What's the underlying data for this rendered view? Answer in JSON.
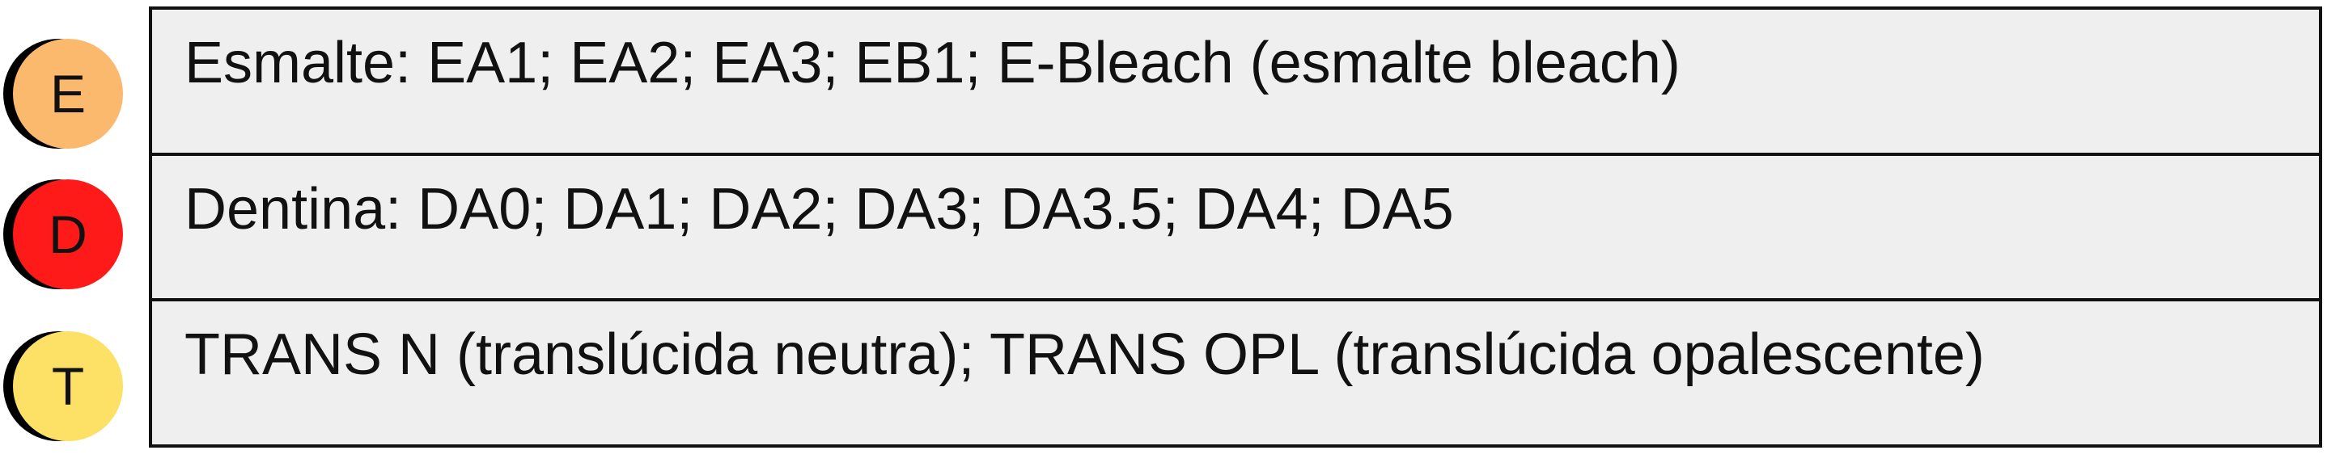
{
  "colors": {
    "enamel": "#fbb96e",
    "dentin": "#ff1a1a",
    "translucent": "#fde066",
    "shadow": "#000000",
    "row_bg": "#f0efef",
    "border": "#111111"
  },
  "rows": [
    {
      "badge_letter": "E",
      "text": "Esmalte: EA1; EA2; EA3; EB1; E-Bleach (esmalte bleach)"
    },
    {
      "badge_letter": "D",
      "text": "Dentina: DA0; DA1; DA2; DA3; DA3.5; DA4; DA5"
    },
    {
      "badge_letter": "T",
      "text": "TRANS N (translúcida neutra); TRANS OPL (translúcida opalescente)"
    }
  ]
}
